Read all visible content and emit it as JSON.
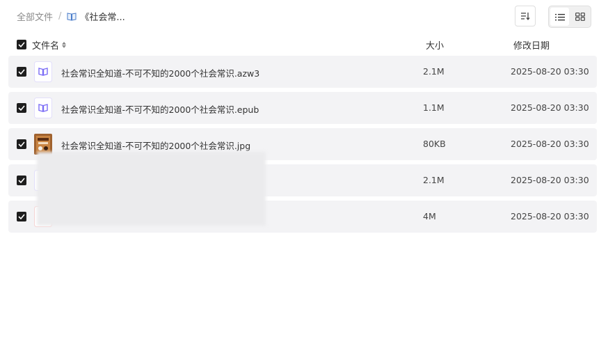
{
  "breadcrumb": {
    "root": "全部文件",
    "separator": "/",
    "current": "《社会常..."
  },
  "columns": {
    "name": "文件名",
    "size": "大小",
    "date": "修改日期"
  },
  "files": [
    {
      "name": "社会常识全知道-不可不知的2000个社会常识.azw3",
      "size": "2.1M",
      "date": "2025-08-20 03:30",
      "icon": "ebook-icon"
    },
    {
      "name": "社会常识全知道-不可不知的2000个社会常识.epub",
      "size": "1.1M",
      "date": "2025-08-20 03:30",
      "icon": "ebook-icon"
    },
    {
      "name": "社会常识全知道-不可不知的2000个社会常识.jpg",
      "size": "80KB",
      "date": "2025-08-20 03:30",
      "icon": "image-thumbnail"
    },
    {
      "name": "",
      "size": "2.1M",
      "date": "2025-08-20 03:30",
      "icon": "ebook-icon"
    },
    {
      "name": "",
      "size": "4M",
      "date": "2025-08-20 03:30",
      "icon": "pdf-icon"
    }
  ],
  "colors": {
    "ebook_icon": "#7b6cf6",
    "row_bg": "#f3f3f5",
    "checkbox": "#1e1e1e"
  }
}
